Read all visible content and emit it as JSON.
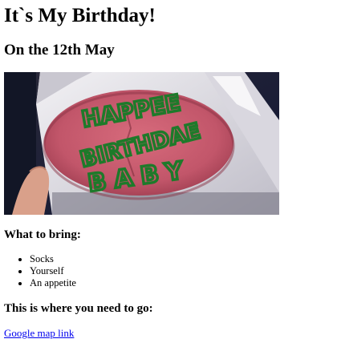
{
  "heading": "It`s My Birthday!",
  "subheading": "On the 12th May",
  "photo": {
    "icing_text_line1": "HAPPEE",
    "icing_text_line2": "BIRTHDAE",
    "icing_text_line3": "BABY",
    "cake_color": "#c95a6c",
    "icing_color": "#1e7a2a",
    "box_color": "#e6e4ea"
  },
  "bring": {
    "title": "What to bring:",
    "items": [
      "Socks",
      "Yourself",
      "An appetite"
    ]
  },
  "location": {
    "title": "This is where you need to go:",
    "link_text": "Google map link"
  },
  "colors": {
    "link": "#0000ee",
    "text": "#000000"
  }
}
